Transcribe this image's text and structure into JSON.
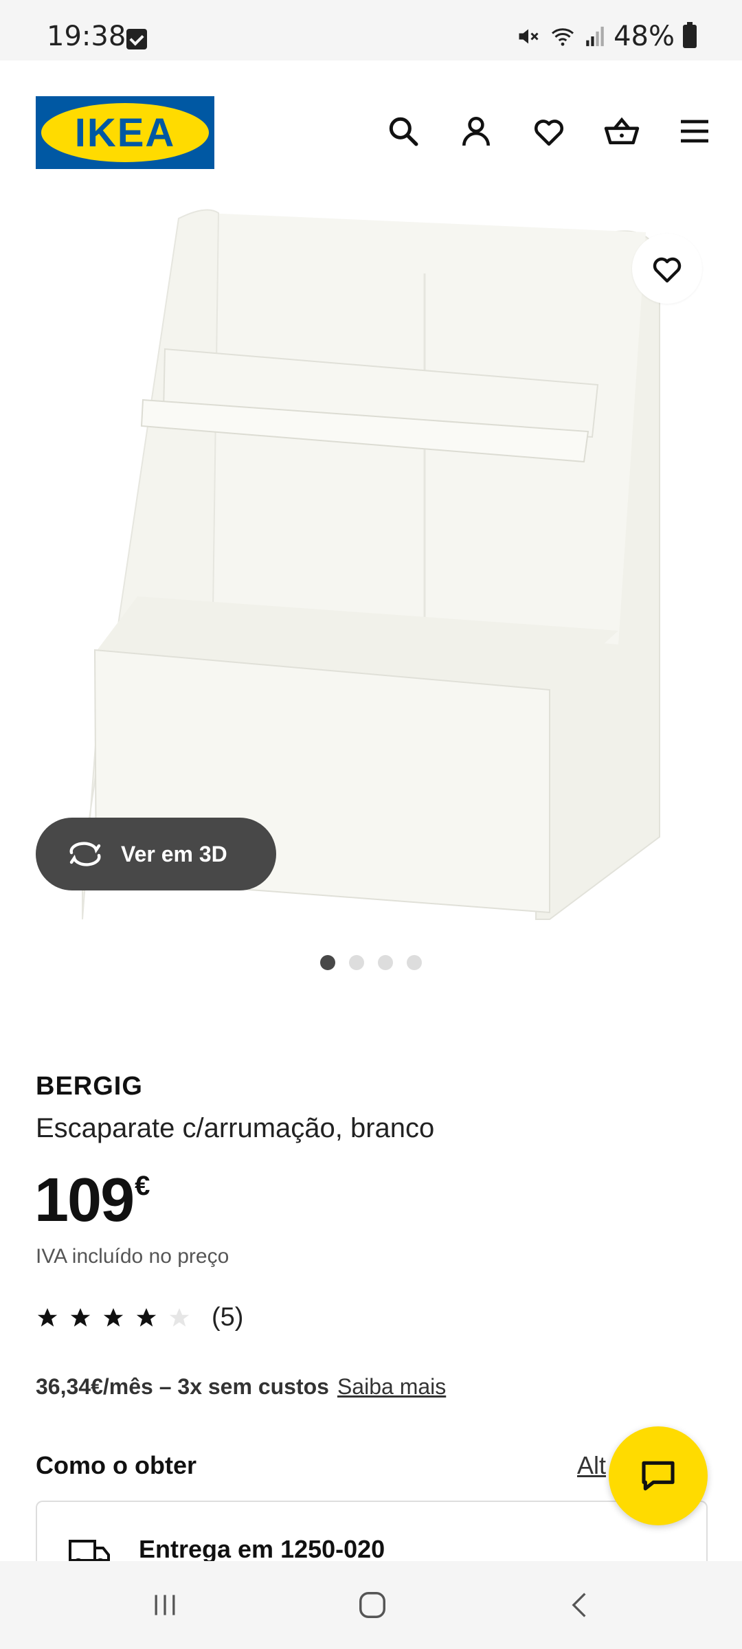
{
  "status_bar": {
    "time": "19:38",
    "battery": "48%"
  },
  "header": {
    "logo_text": "IKEA",
    "icons": [
      "search-icon",
      "account-icon",
      "favorites-icon",
      "basket-icon",
      "menu-icon"
    ]
  },
  "gallery": {
    "view_3d_label": "Ver em 3D",
    "dots": 4,
    "active_dot": 1
  },
  "product": {
    "brand": "BERGIG",
    "description": "Escaparate c/arrumação, branco",
    "price": "109",
    "currency": "€",
    "vat_note": "IVA incluído no preço",
    "rating": 4,
    "rating_max": 5,
    "review_count": "(5)",
    "installment_text": "36,34€/mês – 3x sem custos",
    "installment_link": "Saiba mais"
  },
  "how_to_get": {
    "title": "Como o obter",
    "change_link": "Alt",
    "delivery_text": "Entrega em 1250-020"
  },
  "colors": {
    "ikea_blue": "#0058a3",
    "ikea_yellow": "#ffdb00",
    "dark_button": "#484848"
  }
}
